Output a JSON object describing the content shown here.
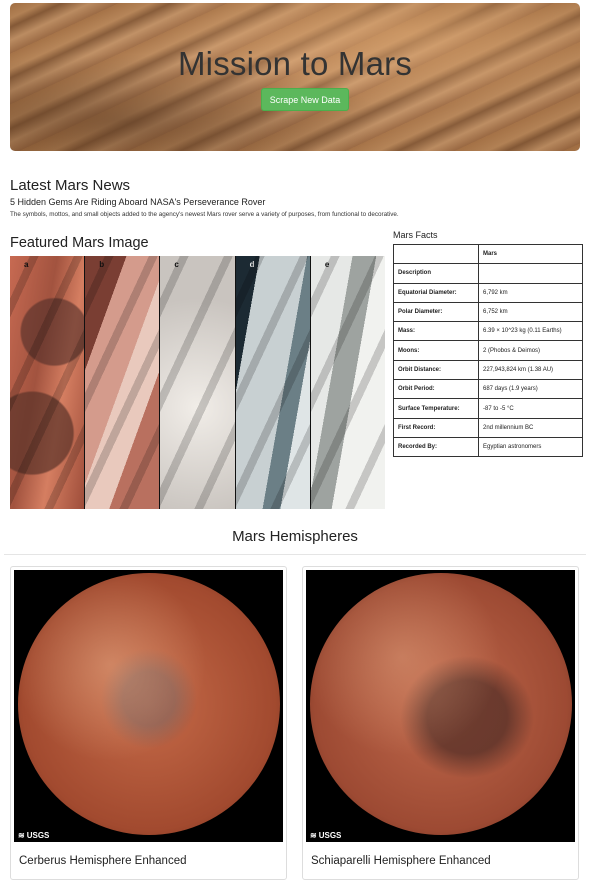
{
  "jumbotron": {
    "title": "Mission to Mars",
    "button_label": "Scrape New Data"
  },
  "news": {
    "heading": "Latest Mars News",
    "title": "5 Hidden Gems Are Riding Aboard NASA's Perseverance Rover",
    "paragraph": "The symbols, mottos, and small objects added to the agency's newest Mars rover serve a variety of purposes, from functional to decorative."
  },
  "featured": {
    "heading": "Featured Mars Image",
    "panel_labels": [
      "a",
      "b",
      "c",
      "d",
      "e"
    ]
  },
  "facts": {
    "heading": "Mars Facts",
    "column_header": "Mars",
    "rows": [
      {
        "key": "Description",
        "value": ""
      },
      {
        "key": "Equatorial Diameter:",
        "value": "6,792 km"
      },
      {
        "key": "Polar Diameter:",
        "value": "6,752 km"
      },
      {
        "key": "Mass:",
        "value": "6.39 × 10^23 kg (0.11 Earths)"
      },
      {
        "key": "Moons:",
        "value": "2 (Phobos & Deimos)"
      },
      {
        "key": "Orbit Distance:",
        "value": "227,943,824 km (1.38 AU)"
      },
      {
        "key": "Orbit Period:",
        "value": "687 days (1.9 years)"
      },
      {
        "key": "Surface Temperature:",
        "value": "-87 to -5 °C"
      },
      {
        "key": "First Record:",
        "value": "2nd millennium BC"
      },
      {
        "key": "Recorded By:",
        "value": "Egyptian astronomers"
      }
    ]
  },
  "hemispheres": {
    "heading": "Mars Hemispheres",
    "items": [
      {
        "title": "Cerberus Hemisphere Enhanced",
        "logo": "USGS"
      },
      {
        "title": "Schiaparelli Hemisphere Enhanced",
        "logo": "USGS"
      }
    ]
  }
}
